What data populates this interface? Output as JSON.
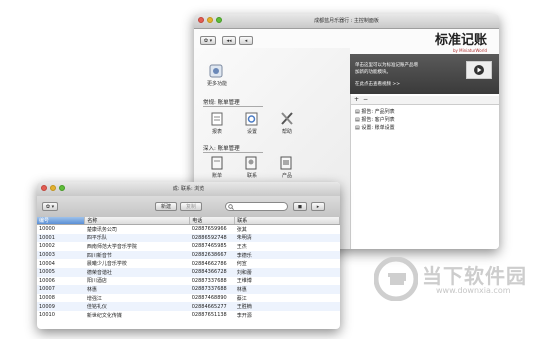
{
  "back_window": {
    "title": "成都蓝月乐器行 : 主控制面板",
    "brand": {
      "main": "标准记账",
      "sub": "by MiniaturWorld"
    },
    "promo": {
      "line1": "单击这里可以为标准记账产品增",
      "line2": "加新的功能模块。",
      "link": "在此点击查看视频 >>"
    },
    "more_label": "更多功能",
    "section1": {
      "title": "常规: 账单管理",
      "items": [
        "报表",
        "设置",
        "帮助"
      ]
    },
    "section2": {
      "title": "深入: 账单管理",
      "items": [
        "账单",
        "联系",
        "产品"
      ]
    },
    "list_toolbar": [
      "+",
      "−"
    ],
    "list_items": [
      "报告: 产品列表",
      "报告: 客户列表",
      "设置: 账单设置"
    ]
  },
  "front_window": {
    "title": "成: 联系: 浏览",
    "toolbar": {
      "new": "新建",
      "copy": "复制"
    },
    "columns": [
      "编号",
      "名称",
      "电话",
      "联系"
    ],
    "rows": [
      [
        "10000",
        "楚康讯务公司",
        "02887659966",
        "张其"
      ],
      [
        "10001",
        "四平乐队",
        "02886592748",
        "朱明清"
      ],
      [
        "10002",
        "西南师范大学音乐学院",
        "02887465985",
        "王杰"
      ],
      [
        "10003",
        "四川新音节",
        "02882638667",
        "李德乐"
      ],
      [
        "10004",
        "晨曦少儿音乐学校",
        "02884662786",
        "何宣"
      ],
      [
        "10005",
        "德荣音谐社",
        "02884366728",
        "刘和蕾"
      ],
      [
        "10006",
        "阳川酒店",
        "02887337688",
        "王维博"
      ],
      [
        "10007",
        "林惠",
        "02887337688",
        "林惠"
      ],
      [
        "10008",
        "增强江",
        "02887468890",
        "蔡江"
      ],
      [
        "10009",
        "佳铭礼仪",
        "02884665277",
        "王胜楠"
      ],
      [
        "10010",
        "新世纪文化传媒",
        "02887651138",
        "李开源"
      ]
    ]
  },
  "watermark": {
    "name": "当下软件园",
    "url": "www.downxia.com"
  },
  "colors": {
    "accent": "#3d7ed6",
    "promo_bg": "#4a4a4a",
    "watermark": "#c9c9c9"
  }
}
